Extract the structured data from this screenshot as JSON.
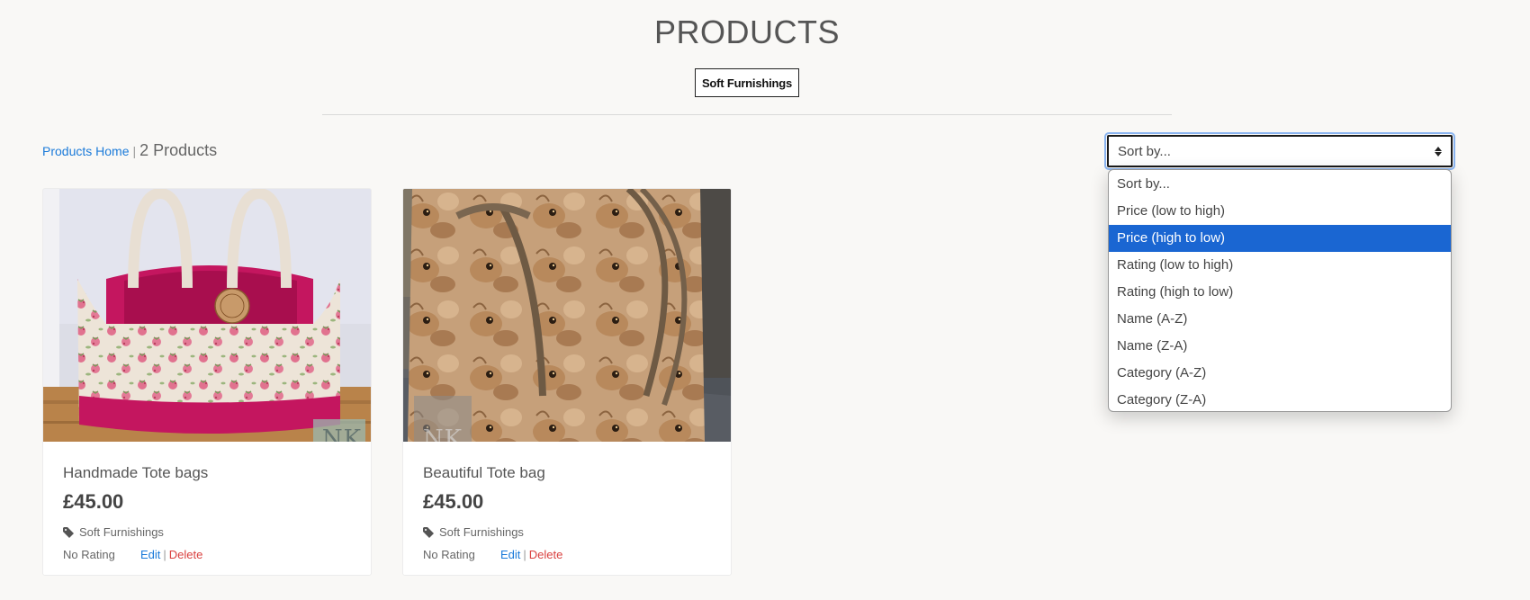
{
  "page": {
    "title": "PRODUCTS",
    "category_badge": "Soft Furnishings"
  },
  "breadcrumb": {
    "home_label": "Products Home",
    "separator": "|",
    "count_label": "2 Products"
  },
  "sort": {
    "current_label": "Sort by...",
    "options": [
      "Sort by...",
      "Price (low to high)",
      "Price (high to low)",
      "Rating (low to high)",
      "Rating (high to low)",
      "Name (A-Z)",
      "Name (Z-A)",
      "Category (A-Z)",
      "Category (Z-A)"
    ],
    "highlighted_option": "Price (high to low)"
  },
  "products": [
    {
      "name": "Handmade Tote bags",
      "price": "£45.00",
      "category": "Soft Furnishings",
      "rating": "No Rating",
      "edit_label": "Edit",
      "separator": "|",
      "delete_label": "Delete",
      "image_subject": "strawberry-print-tote-bag",
      "watermark": "NK"
    },
    {
      "name": "Beautiful Tote bag",
      "price": "£45.00",
      "category": "Soft Furnishings",
      "rating": "No Rating",
      "edit_label": "Edit",
      "separator": "|",
      "delete_label": "Delete",
      "image_subject": "hare-print-tote-bag",
      "watermark": "NK"
    }
  ],
  "colors": {
    "link": "#1a7ad9",
    "delete": "#d9403f",
    "dropdown_highlight": "#1a66d2",
    "background": "#f9f8f6"
  },
  "icons": {
    "category": "tag-icon",
    "sort": "sort-arrows-icon"
  }
}
